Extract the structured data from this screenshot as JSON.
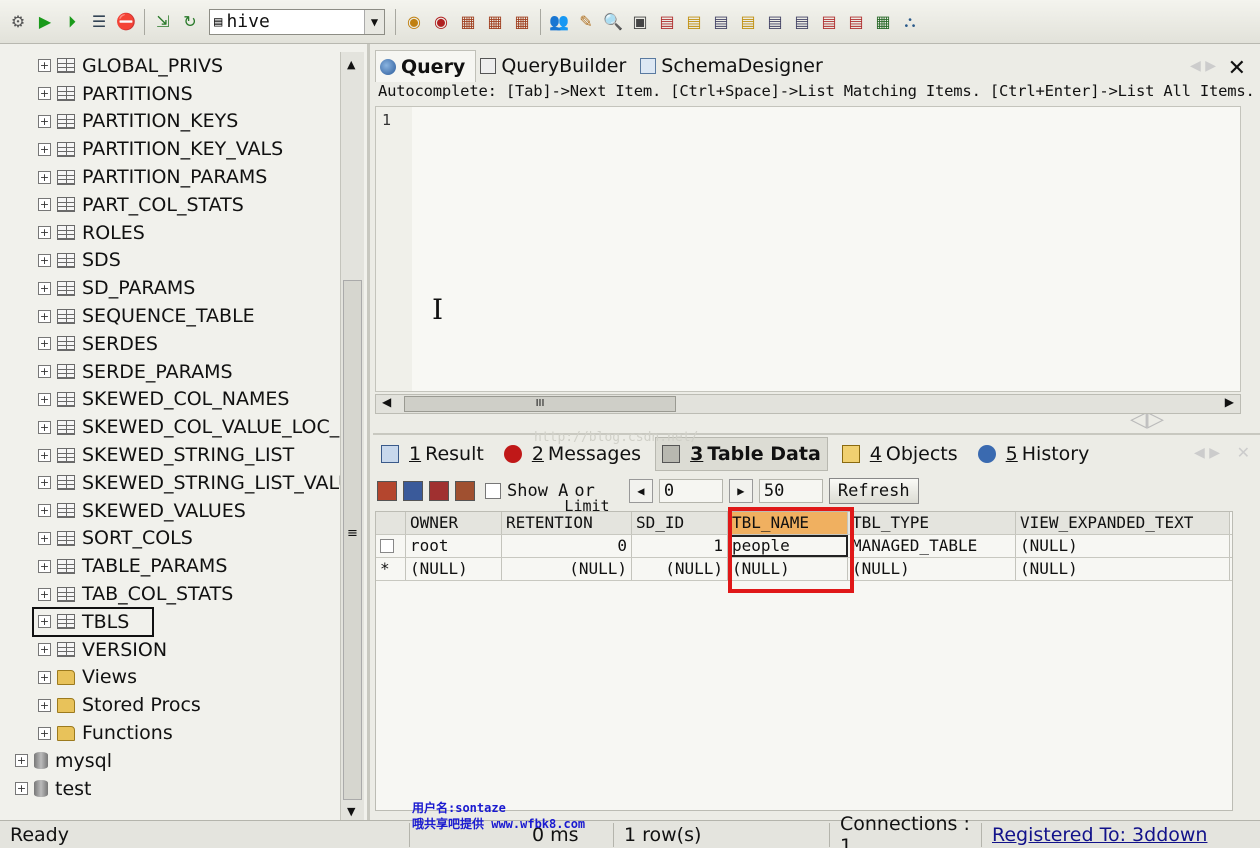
{
  "toolbar": {
    "database": "hive",
    "icons": [
      "connect-icon",
      "execute-icon",
      "execute-all-icon",
      "format-icon",
      "stop-icon",
      "import-icon",
      "refresh-icon",
      "db-icon",
      "object-icons",
      "users-icon",
      "brush-icon",
      "search-icon",
      "table-icons",
      "grid-icon"
    ]
  },
  "tree": {
    "tables": [
      "GLOBAL_PRIVS",
      "PARTITIONS",
      "PARTITION_KEYS",
      "PARTITION_KEY_VALS",
      "PARTITION_PARAMS",
      "PART_COL_STATS",
      "ROLES",
      "SDS",
      "SD_PARAMS",
      "SEQUENCE_TABLE",
      "SERDES",
      "SERDE_PARAMS",
      "SKEWED_COL_NAMES",
      "SKEWED_COL_VALUE_LOC_M",
      "SKEWED_STRING_LIST",
      "SKEWED_STRING_LIST_VALU",
      "SKEWED_VALUES",
      "SORT_COLS",
      "TABLE_PARAMS",
      "TAB_COL_STATS",
      "TBLS",
      "VERSION"
    ],
    "folders": [
      "Views",
      "Stored Procs",
      "Functions"
    ],
    "databases": [
      "mysql",
      "test"
    ]
  },
  "editor": {
    "tabs": [
      "Query",
      "QueryBuilder",
      "SchemaDesigner"
    ],
    "autocomplete": "Autocomplete: [Tab]->Next Item. [Ctrl+Space]->List Matching Items. [Ctrl+Enter]->List All Items.",
    "line_number": "1",
    "scroll_grip": "III"
  },
  "results": {
    "tabs": [
      {
        "num": "1",
        "label": "Result"
      },
      {
        "num": "2",
        "label": "Messages"
      },
      {
        "num": "3",
        "label": "Table Data"
      },
      {
        "num": "4",
        "label": "Objects"
      },
      {
        "num": "5",
        "label": "History"
      }
    ],
    "show_all_label": "Show A",
    "or_limit_label": "or",
    "limit_label": "Limit",
    "offset": "0",
    "limit": "50",
    "refresh_label": "Refresh",
    "columns": [
      "OWNER",
      "RETENTION",
      "SD_ID",
      "TBL_NAME",
      "TBL_TYPE",
      "VIEW_EXPANDED_TEXT"
    ],
    "rows": [
      {
        "marker": "",
        "cells": [
          "root",
          "0",
          "1",
          "people",
          "MANAGED_TABLE",
          "(NULL)"
        ]
      },
      {
        "marker": "*",
        "cells": [
          "(NULL)",
          "(NULL)",
          "(NULL)",
          "(NULL)",
          "(NULL)",
          "(NULL)"
        ]
      }
    ]
  },
  "watermark": {
    "url": "http://blog.csdn.net/",
    "line1": "用户名:sontaze",
    "line2": "哦共享吧提供 www.wfbk8.com"
  },
  "status": {
    "ready": "Ready",
    "time": "0 ms",
    "rows": "1 row(s)",
    "connections": "Connections : 1",
    "registered": "Registered To: 3ddown"
  },
  "colors": {
    "highlight_box": "#e01818",
    "header_highlight": "#f0b060"
  }
}
